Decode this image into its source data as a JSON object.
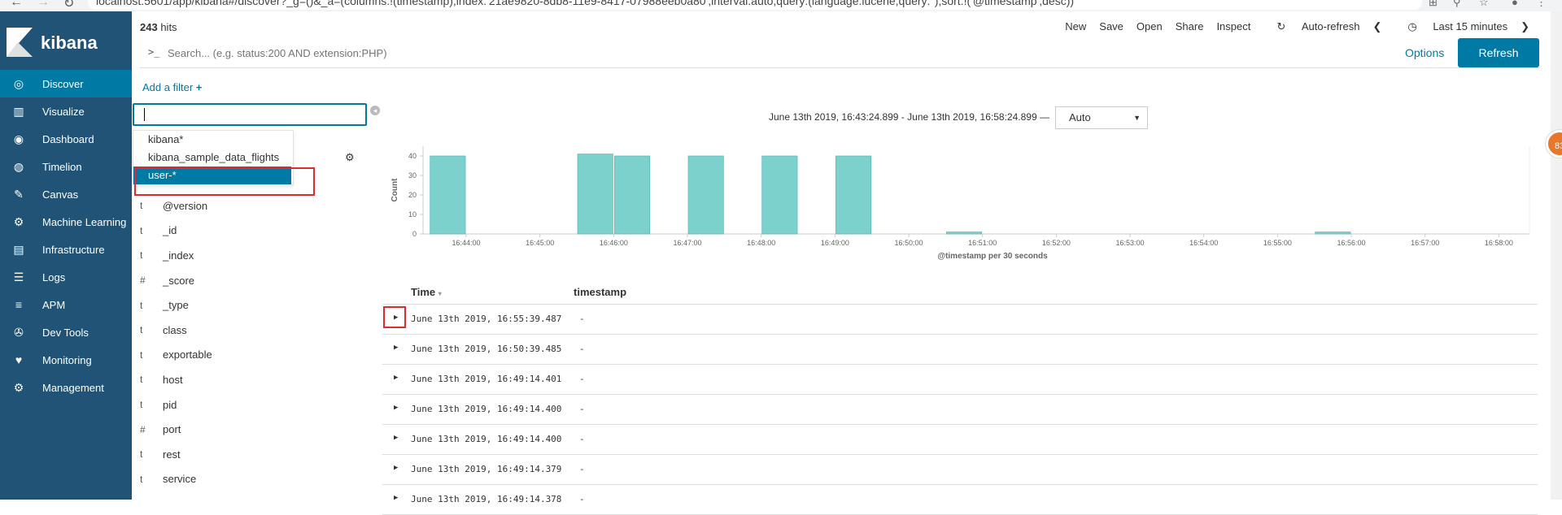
{
  "browser": {
    "url": "localhost:5601/app/kibana#/discover?_g=()&_a=(columns:!(timestamp),index:'21ae9820-8db8-11e9-8417-07988eeb0a80',interval:auto,query:(language:lucene,query:''),sort:!('@timestamp',desc))"
  },
  "brand": {
    "name": "kibana"
  },
  "nav": [
    {
      "label": "Discover",
      "icon": "compass-icon",
      "glyph": "◎"
    },
    {
      "label": "Visualize",
      "icon": "bar-chart-icon",
      "glyph": "▥"
    },
    {
      "label": "Dashboard",
      "icon": "dashboard-icon",
      "glyph": "◉"
    },
    {
      "label": "Timelion",
      "icon": "timelion-icon",
      "glyph": "◍"
    },
    {
      "label": "Canvas",
      "icon": "canvas-icon",
      "glyph": "✎"
    },
    {
      "label": "Machine Learning",
      "icon": "ml-icon",
      "glyph": "⚙"
    },
    {
      "label": "Infrastructure",
      "icon": "infrastructure-icon",
      "glyph": "▤"
    },
    {
      "label": "Logs",
      "icon": "logs-icon",
      "glyph": "☰"
    },
    {
      "label": "APM",
      "icon": "apm-icon",
      "glyph": "≡"
    },
    {
      "label": "Dev Tools",
      "icon": "wrench-icon",
      "glyph": "✇"
    },
    {
      "label": "Monitoring",
      "icon": "heartbeat-icon",
      "glyph": "♥"
    },
    {
      "label": "Management",
      "icon": "gear-icon",
      "glyph": "⚙"
    }
  ],
  "hits": {
    "count": "243",
    "suffix": "hits"
  },
  "top_menu": {
    "new": "New",
    "save": "Save",
    "open": "Open",
    "share": "Share",
    "inspect": "Inspect",
    "auto_refresh": "Auto-refresh",
    "time": "Last 15 minutes"
  },
  "query": {
    "prompt": ">_",
    "placeholder": "Search... (e.g. status:200 AND extension:PHP)",
    "options": "Options",
    "refresh": "Refresh"
  },
  "add_filter": "Add a filter",
  "index_dropdown": [
    "kibana*",
    "kibana_sample_data_flights",
    "user-*"
  ],
  "fields": [
    {
      "type": "t",
      "name": "@version"
    },
    {
      "type": "t",
      "name": "_id"
    },
    {
      "type": "t",
      "name": "_index"
    },
    {
      "type": "#",
      "name": "_score"
    },
    {
      "type": "t",
      "name": "_type"
    },
    {
      "type": "t",
      "name": "class"
    },
    {
      "type": "t",
      "name": "exportable"
    },
    {
      "type": "t",
      "name": "host"
    },
    {
      "type": "t",
      "name": "pid"
    },
    {
      "type": "#",
      "name": "port"
    },
    {
      "type": "t",
      "name": "rest"
    },
    {
      "type": "t",
      "name": "service"
    }
  ],
  "time_range": "June 13th 2019, 16:43:24.899 - June 13th 2019, 16:58:24.899 —",
  "interval": "Auto",
  "chart_data": {
    "type": "bar",
    "xlabel": "@timestamp per 30 seconds",
    "ylabel": "Count",
    "ylim": [
      0,
      45
    ],
    "yticks": [
      0,
      10,
      20,
      30,
      40
    ],
    "x_tick_labels": [
      "16:44:00",
      "16:45:00",
      "16:46:00",
      "16:47:00",
      "16:48:00",
      "16:49:00",
      "16:50:00",
      "16:51:00",
      "16:52:00",
      "16:53:00",
      "16:54:00",
      "16:55:00",
      "16:56:00",
      "16:57:00",
      "16:58:00"
    ],
    "bars": [
      {
        "t": "16:43:30",
        "value": 40
      },
      {
        "t": "16:45:30",
        "value": 41
      },
      {
        "t": "16:46:00",
        "value": 40
      },
      {
        "t": "16:47:00",
        "value": 40
      },
      {
        "t": "16:48:00",
        "value": 40
      },
      {
        "t": "16:49:00",
        "value": 40
      },
      {
        "t": "16:50:30",
        "value": 1
      },
      {
        "t": "16:55:30",
        "value": 1
      }
    ],
    "bar_color": "#7dd1cd"
  },
  "table": {
    "col_time": "Time",
    "col_timestamp": "timestamp",
    "rows": [
      {
        "time": "June 13th 2019, 16:55:39.487",
        "timestamp": "-"
      },
      {
        "time": "June 13th 2019, 16:50:39.485",
        "timestamp": "-"
      },
      {
        "time": "June 13th 2019, 16:49:14.401",
        "timestamp": "-"
      },
      {
        "time": "June 13th 2019, 16:49:14.400",
        "timestamp": "-"
      },
      {
        "time": "June 13th 2019, 16:49:14.400",
        "timestamp": "-"
      },
      {
        "time": "June 13th 2019, 16:49:14.379",
        "timestamp": "-"
      },
      {
        "time": "June 13th 2019, 16:49:14.378",
        "timestamp": "-"
      }
    ]
  },
  "badge": "83"
}
